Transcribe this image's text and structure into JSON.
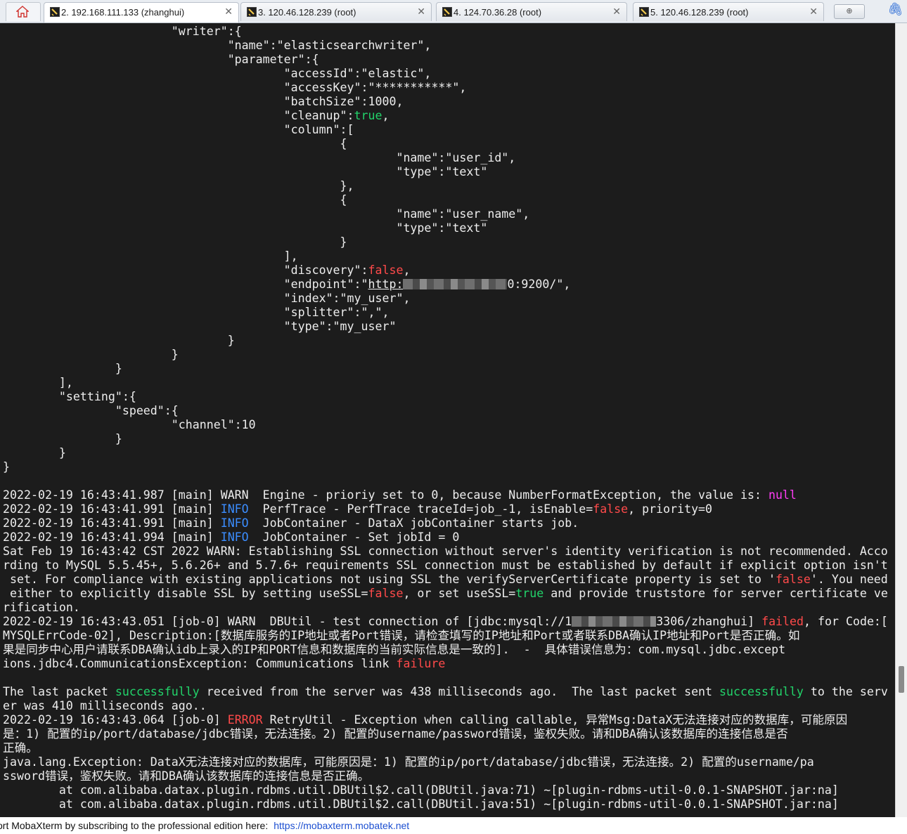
{
  "tabs": [
    {
      "label": "2. 192.168.111.133 (zhanghui)",
      "active": true,
      "closable": true
    },
    {
      "label": "3. 120.46.128.239 (root)",
      "active": false,
      "closable": true
    },
    {
      "label": "4. 124.70.36.28 (root)",
      "active": false,
      "closable": true
    },
    {
      "label": "5. 120.46.128.239 (root)",
      "active": false,
      "closable": true
    }
  ],
  "tab_close_glyph": "✕",
  "new_tab_glyph": "⊕",
  "icons": {
    "home": "home-icon",
    "terminal": "ssh-terminal-icon",
    "attach": "paperclip-icon"
  },
  "colors": {
    "terminal_bg": "#1c1c1c",
    "text": "#ededed",
    "green": "#22d36a",
    "red": "#ff4a4a",
    "magenta": "#ff3df5",
    "blue": "#3b8dff"
  },
  "terminal": {
    "lines": [
      [
        {
          "t": "                        \"writer\":{"
        }
      ],
      [
        {
          "t": "                                \"name\":\"elasticsearchwriter\","
        }
      ],
      [
        {
          "t": "                                \"parameter\":{"
        }
      ],
      [
        {
          "t": "                                        \"accessId\":\"elastic\","
        }
      ],
      [
        {
          "t": "                                        \"accessKey\":\"***********\","
        }
      ],
      [
        {
          "t": "                                        \"batchSize\":1000,"
        }
      ],
      [
        {
          "t": "                                        \"cleanup\":"
        },
        {
          "t": "true",
          "c": "g"
        },
        {
          "t": ","
        }
      ],
      [
        {
          "t": "                                        \"column\":["
        }
      ],
      [
        {
          "t": "                                                {"
        }
      ],
      [
        {
          "t": "                                                        \"name\":\"user_id\","
        }
      ],
      [
        {
          "t": "                                                        \"type\":\"text\""
        }
      ],
      [
        {
          "t": "                                                },"
        }
      ],
      [
        {
          "t": "                                                {"
        }
      ],
      [
        {
          "t": "                                                        \"name\":\"user_name\","
        }
      ],
      [
        {
          "t": "                                                        \"type\":\"text\""
        }
      ],
      [
        {
          "t": "                                                }"
        }
      ],
      [
        {
          "t": "                                        ],"
        }
      ],
      [
        {
          "t": "                                        \"discovery\":"
        },
        {
          "t": "false",
          "c": "r"
        },
        {
          "t": ","
        }
      ],
      [
        {
          "t": "                                        \"endpoint\":\""
        },
        {
          "t": "http:",
          "c": "u"
        },
        {
          "blur": "w1"
        },
        {
          "t": "0:9200/\","
        }
      ],
      [
        {
          "t": "                                        \"index\":\"my_user\","
        }
      ],
      [
        {
          "t": "                                        \"splitter\":\",\","
        }
      ],
      [
        {
          "t": "                                        \"type\":\"my_user\""
        }
      ],
      [
        {
          "t": "                                }"
        }
      ],
      [
        {
          "t": "                        }"
        }
      ],
      [
        {
          "t": "                }"
        }
      ],
      [
        {
          "t": "        ],"
        }
      ],
      [
        {
          "t": "        \"setting\":{"
        }
      ],
      [
        {
          "t": "                \"speed\":{"
        }
      ],
      [
        {
          "t": "                        \"channel\":10"
        }
      ],
      [
        {
          "t": "                }"
        }
      ],
      [
        {
          "t": "        }"
        }
      ],
      [
        {
          "t": "}"
        }
      ],
      [
        {
          "t": ""
        }
      ],
      [
        {
          "t": "2022-02-19 16:43:41.987 [main] WARN  Engine - prioriy set to 0, because NumberFormatException, the value is: "
        },
        {
          "t": "null",
          "c": "m"
        }
      ],
      [
        {
          "t": "2022-02-19 16:43:41.991 [main] "
        },
        {
          "t": "INFO",
          "c": "b"
        },
        {
          "t": "  PerfTrace - PerfTrace traceId=job_-1, isEnable="
        },
        {
          "t": "false",
          "c": "r"
        },
        {
          "t": ", priority=0"
        }
      ],
      [
        {
          "t": "2022-02-19 16:43:41.991 [main] "
        },
        {
          "t": "INFO",
          "c": "b"
        },
        {
          "t": "  JobContainer - DataX jobContainer starts job."
        }
      ],
      [
        {
          "t": "2022-02-19 16:43:41.994 [main] "
        },
        {
          "t": "INFO",
          "c": "b"
        },
        {
          "t": "  JobContainer - Set jobId = 0"
        }
      ],
      [
        {
          "t": "Sat Feb 19 16:43:42 CST 2022 WARN: Establishing SSL connection without server's identity verification is not recommended. Acco"
        }
      ],
      [
        {
          "t": "rding to MySQL 5.5.45+, 5.6.26+ and 5.7.6+ requirements SSL connection must be established by default if explicit option isn't"
        }
      ],
      [
        {
          "t": " set. For compliance with existing applications not using SSL the verifyServerCertificate property is set to '"
        },
        {
          "t": "false",
          "c": "r"
        },
        {
          "t": "'. You need"
        }
      ],
      [
        {
          "t": " either to explicitly disable SSL by setting useSSL="
        },
        {
          "t": "false",
          "c": "r"
        },
        {
          "t": ", or set useSSL="
        },
        {
          "t": "true",
          "c": "g"
        },
        {
          "t": " and provide truststore for server certificate ve"
        }
      ],
      [
        {
          "t": "rification."
        }
      ],
      [
        {
          "t": "2022-02-19 16:43:43.051 [job-0] WARN  DBUtil - test connection of [jdbc:mysql://1"
        },
        {
          "blur": "w2"
        },
        {
          "t": "3306/zhanghui] "
        },
        {
          "t": "failed",
          "c": "r"
        },
        {
          "t": ", for Code:["
        }
      ],
      [
        {
          "t": "MYSQLErrCode-02], Description:[数据库服务的IP地址或者Port错误，请检查填写的IP地址和Port或者联系DBA确认IP地址和Port是否正确。如"
        }
      ],
      [
        {
          "t": "果是同步中心用户请联系DBA确认idb上录入的IP和PORT信息和数据库的当前实际信息是一致的].  -  具体错误信息为：com.mysql.jdbc.except"
        }
      ],
      [
        {
          "t": "ions.jdbc4.CommunicationsException: Communications link "
        },
        {
          "t": "failure",
          "c": "r"
        }
      ],
      [
        {
          "t": ""
        }
      ],
      [
        {
          "t": "The last packet "
        },
        {
          "t": "successfully",
          "c": "g"
        },
        {
          "t": " received from the server was 438 milliseconds ago.  The last packet sent "
        },
        {
          "t": "successfully",
          "c": "g"
        },
        {
          "t": " to the serv"
        }
      ],
      [
        {
          "t": "er was 410 milliseconds ago.."
        }
      ],
      [
        {
          "t": "2022-02-19 16:43:43.064 [job-0] "
        },
        {
          "t": "ERROR",
          "c": "r"
        },
        {
          "t": " RetryUtil - Exception when calling callable, 异常Msg:DataX无法连接对应的数据库，可能原因"
        }
      ],
      [
        {
          "t": "是：1) 配置的ip/port/database/jdbc错误，无法连接。2) 配置的username/password错误，鉴权失败。请和DBA确认该数据库的连接信息是否"
        }
      ],
      [
        {
          "t": "正确。"
        }
      ],
      [
        {
          "t": "java.lang.Exception: DataX无法连接对应的数据库，可能原因是：1) 配置的ip/port/database/jdbc错误，无法连接。2) 配置的username/pa"
        }
      ],
      [
        {
          "t": "ssword错误，鉴权失败。请和DBA确认该数据库的连接信息是否正确。"
        }
      ],
      [
        {
          "t": "        at com.alibaba.datax.plugin.rdbms.util.DBUtil$2.call(DBUtil.java:71) ~[plugin-rdbms-util-0.0.1-SNAPSHOT.jar:na]"
        }
      ],
      [
        {
          "t": "        at com.alibaba.datax.plugin.rdbms.util.DBUtil$2.call(DBUtil.java:51) ~[plugin-rdbms-util-0.0.1-SNAPSHOT.jar:na]"
        }
      ]
    ]
  },
  "footer": {
    "text": "ort MobaXterm by subscribing to the professional edition here:",
    "link": "https://mobaxterm.mobatek.net"
  }
}
